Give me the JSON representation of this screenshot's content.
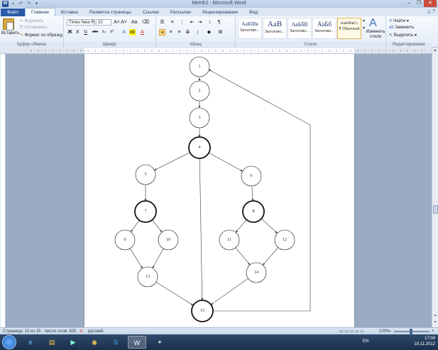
{
  "window": {
    "title": "Metrik2 - Microsoft Word",
    "controls": [
      "–",
      "❐",
      "✕"
    ]
  },
  "tabs": [
    {
      "label": "Файл"
    },
    {
      "label": "Главная"
    },
    {
      "label": "Вставка"
    },
    {
      "label": "Разметка страницы"
    },
    {
      "label": "Ссылки"
    },
    {
      "label": "Рассылки"
    },
    {
      "label": "Рецензирование"
    },
    {
      "label": "Вид"
    }
  ],
  "ribbon": {
    "clipboard": {
      "paste_label": "Вставить",
      "cut_label": "Вырезать",
      "copy_label": "Копировать",
      "format_painter_label": "Формат по образцу",
      "group_label": "Буфер обмена"
    },
    "font": {
      "font_name": "Times New Ro",
      "font_size": "10",
      "bold": "Ж",
      "italic": "К",
      "underline": "Ч",
      "strike": "abc",
      "subscript": "x₂",
      "superscript": "x²",
      "grow": "A˄",
      "shrink": "A˅",
      "case": "Aa",
      "group_label": "Шрифт"
    },
    "paragraph": {
      "group_label": "Абзац"
    },
    "styles": {
      "items": [
        {
          "sample": "АаБбВв",
          "name": "Заголово..."
        },
        {
          "sample": "AaB",
          "name": "Заголово..."
        },
        {
          "sample": "АаБбВ",
          "name": "Заголово..."
        },
        {
          "sample": "АаБб",
          "name": "Заголово..."
        },
        {
          "sample": "АаБбВвГг,",
          "name": "¶ Обычный"
        }
      ],
      "change_styles_label": "Изменить стили",
      "group_label": "Стили"
    },
    "editing": {
      "find_label": "Найти",
      "replace_label": "Заменить",
      "select_label": "Выделить",
      "group_label": "Редактирование"
    }
  },
  "graph": {
    "nodes": [
      {
        "id": "1",
        "label": "1",
        "bold": false
      },
      {
        "id": "2",
        "label": "2",
        "bold": false
      },
      {
        "id": "3",
        "label": "3",
        "bold": false
      },
      {
        "id": "4",
        "label": "4",
        "bold": true
      },
      {
        "id": "5",
        "label": "5",
        "bold": false
      },
      {
        "id": "6",
        "label": "6",
        "bold": false
      },
      {
        "id": "7",
        "label": "7",
        "bold": true
      },
      {
        "id": "8",
        "label": "8",
        "bold": true
      },
      {
        "id": "9",
        "label": "9",
        "bold": false
      },
      {
        "id": "10",
        "label": "10",
        "bold": false
      },
      {
        "id": "11",
        "label": "11",
        "bold": false
      },
      {
        "id": "12",
        "label": "12",
        "bold": false
      },
      {
        "id": "13",
        "label": "13",
        "bold": false
      },
      {
        "id": "14",
        "label": "14",
        "bold": false
      },
      {
        "id": "15",
        "label": "15",
        "bold": true
      }
    ],
    "edges": [
      [
        "1",
        "2"
      ],
      [
        "2",
        "3"
      ],
      [
        "3",
        "4"
      ],
      [
        "4",
        "5"
      ],
      [
        "4",
        "6"
      ],
      [
        "4",
        "15"
      ],
      [
        "5",
        "7"
      ],
      [
        "6",
        "8"
      ],
      [
        "7",
        "9"
      ],
      [
        "7",
        "10"
      ],
      [
        "8",
        "11"
      ],
      [
        "8",
        "12"
      ],
      [
        "9",
        "13"
      ],
      [
        "10",
        "13"
      ],
      [
        "11",
        "14"
      ],
      [
        "12",
        "14"
      ],
      [
        "13",
        "15"
      ],
      [
        "14",
        "15"
      ],
      [
        "15",
        "1"
      ]
    ]
  },
  "statusbar": {
    "page": "Страница: 10 из 15",
    "words": "Число слов: 625",
    "language": "русский",
    "zoom": "100%"
  },
  "taskbar": {
    "language": "EN",
    "time": "17:04",
    "date": "18.11.2012"
  }
}
